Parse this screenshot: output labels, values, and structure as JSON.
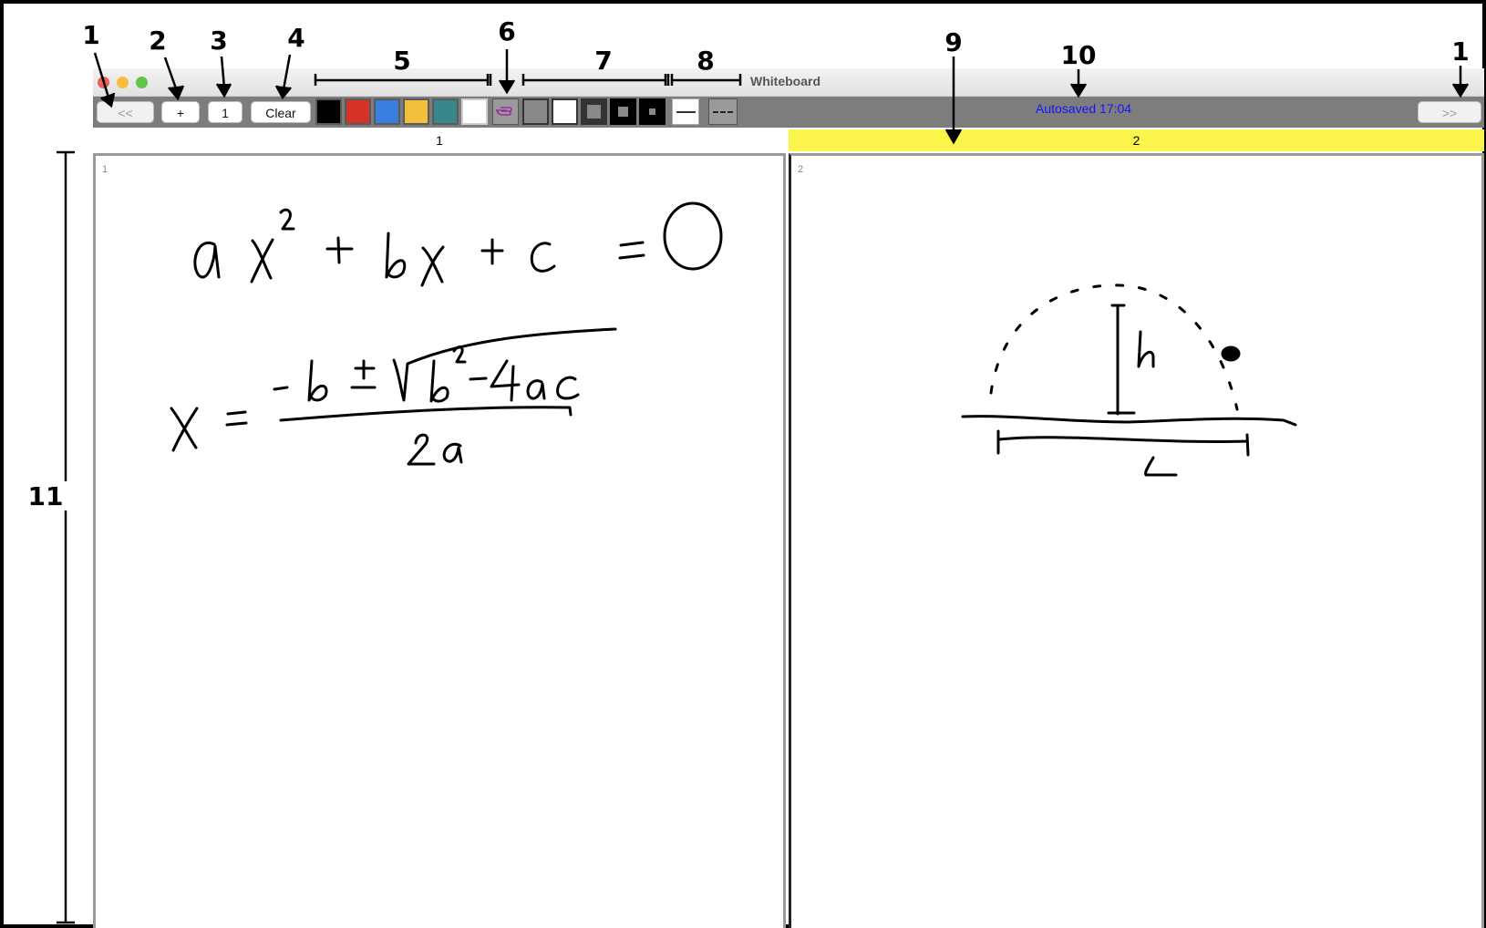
{
  "window": {
    "title": "Whiteboard"
  },
  "toolbar": {
    "prev_label": "<<",
    "add_label": "+",
    "page_number": "1",
    "clear_label": "Clear",
    "next_label": ">>",
    "colors": [
      "#000000",
      "#d83127",
      "#3a7fe0",
      "#f2c03c",
      "#37878c",
      "#ffffff"
    ],
    "pen_sizes": [
      "size-1",
      "size-2",
      "size-3",
      "size-4",
      "size-5"
    ],
    "line_styles": [
      "solid-line",
      "dashed-line"
    ],
    "autosave_text": "Autosaved 17:04"
  },
  "tabs": [
    {
      "label": "1",
      "active": false
    },
    {
      "label": "2",
      "active": true,
      "highlight": "#fbf44a"
    }
  ],
  "pages": [
    {
      "number": "1"
    },
    {
      "number": "2"
    }
  ],
  "annotations": [
    "1",
    "2",
    "3",
    "4",
    "5",
    "6",
    "7",
    "8",
    "9",
    "10",
    "1",
    "11"
  ]
}
